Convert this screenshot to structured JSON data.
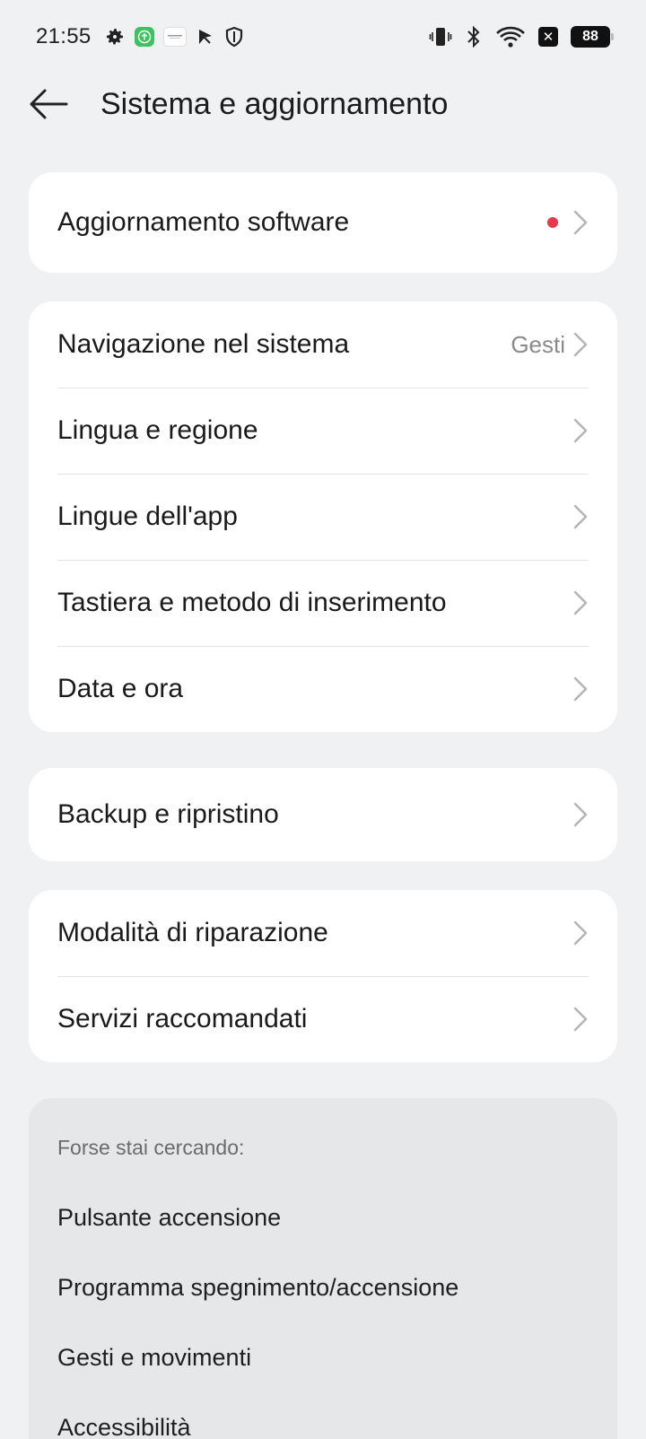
{
  "status_bar": {
    "time": "21:55",
    "battery": "88",
    "left_icons": [
      "gear-icon",
      "upload-app-icon",
      "app-thumbnail-icon",
      "play-flag-icon",
      "shield-icon"
    ],
    "right_icons": [
      "vibrate-icon",
      "bluetooth-icon",
      "wifi-icon",
      "sim-off-icon",
      "battery-icon"
    ]
  },
  "header": {
    "title": "Sistema e aggiornamento"
  },
  "groups": [
    {
      "items": [
        {
          "label": "Aggiornamento software",
          "has_dot": true,
          "dot_color": "#e8384f"
        }
      ]
    },
    {
      "items": [
        {
          "label": "Navigazione nel sistema",
          "value": "Gesti"
        },
        {
          "label": "Lingua e regione"
        },
        {
          "label": "Lingue dell'app"
        },
        {
          "label": "Tastiera e metodo di inserimento"
        },
        {
          "label": "Data e ora"
        }
      ]
    },
    {
      "items": [
        {
          "label": "Backup e ripristino"
        }
      ]
    },
    {
      "items": [
        {
          "label": "Modalità di riparazione"
        },
        {
          "label": "Servizi raccomandati"
        }
      ]
    }
  ],
  "suggestions": {
    "heading": "Forse stai cercando:",
    "items": [
      "Pulsante accensione",
      "Programma spegnimento/accensione",
      "Gesti e movimenti",
      "Accessibilità"
    ]
  }
}
